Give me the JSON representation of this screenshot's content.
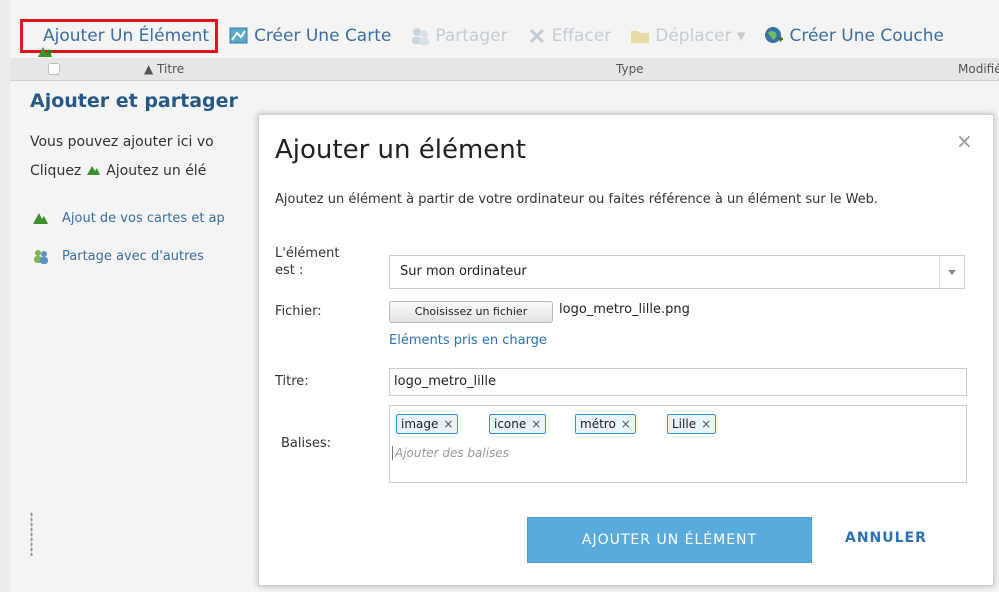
{
  "toolbar": {
    "add_item": "Ajouter Un Élément",
    "create_map": "Créer Une Carte",
    "share": "Partager",
    "delete": "Effacer",
    "move": "Déplacer ▾",
    "create_layer": "Créer Une Couche"
  },
  "list_header": {
    "title_col": "▲ Titre",
    "type_col": "Type",
    "modified_col": "Modifié"
  },
  "content": {
    "section_title": "Ajouter et partager",
    "intro_line1": "Vous pouvez ajouter ici vo",
    "intro_line2_prefix": "Cliquez",
    "intro_line2_suffix": "Ajoutez un élé",
    "link_add_maps": "Ajout de vos cartes et ap",
    "link_share": "Partage avec d'autres"
  },
  "dialog": {
    "title": "Ajouter un élément",
    "close": "×",
    "description": "Ajoutez un élément à partir de votre ordinateur ou faites référence à un élément sur le Web.",
    "source_label_line1": "L'élément",
    "source_label_line2": "est :",
    "source_value": "Sur mon ordinateur",
    "file_label": "Fichier:",
    "file_button": "Choisissez un fichier",
    "file_name": "logo_metro_lille.png",
    "supported_link": "Eléments pris en charge",
    "title_label": "Titre:",
    "title_value": "logo_metro_lille",
    "tags_label": "Balises:",
    "tags": [
      "image",
      "icone",
      "métro",
      "Lille"
    ],
    "tag_remove": "×",
    "tags_placeholder": "Ajouter des balises",
    "submit_button": "AJOUTER UN ÉLÉMENT",
    "cancel_button": "ANNULER"
  },
  "colors": {
    "highlight_border": "#e0141a",
    "primary_button": "#5aabdd",
    "link": "#2a72b5",
    "heading": "#265a86"
  },
  "icons": {
    "add_item": "add-item-icon",
    "create_map": "map-icon",
    "share": "share-users-icon",
    "delete": "delete-x-icon",
    "move": "folder-icon",
    "create_layer": "globe-layer-icon"
  }
}
